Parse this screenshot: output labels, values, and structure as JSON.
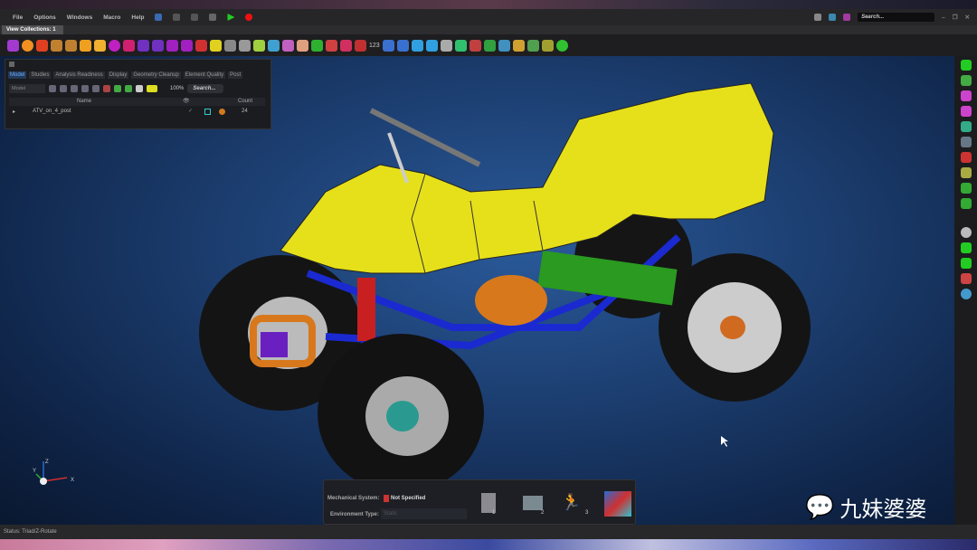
{
  "menu": [
    "File",
    "Options",
    "Windows",
    "Macro",
    "Help"
  ],
  "tab": "View Collections: 1",
  "top_search": "Search...",
  "browser": {
    "tabs": [
      "Model",
      "Studies",
      "Analysis Readiness",
      "Display",
      "Geometry Cleanup",
      "Element Quality",
      "Post"
    ],
    "filter": "Model",
    "zoom": "100%",
    "search": "Search...",
    "col_name": "Name",
    "col_count": "Count",
    "rows": [
      {
        "name": "ATV_on_4_post",
        "count": "24"
      }
    ]
  },
  "bottom": {
    "mech_label": "Mechanical System:",
    "mech_value": "Not Specified",
    "env_label": "Environment Type:",
    "env_value": "Static",
    "steps": [
      "1",
      "2",
      "3"
    ]
  },
  "toolbar_count": "123",
  "status": "Status: Triad/Z-Rotate",
  "triad": {
    "x": "X",
    "y": "Y",
    "z": "Z"
  },
  "watermark": "九妹婆婆"
}
